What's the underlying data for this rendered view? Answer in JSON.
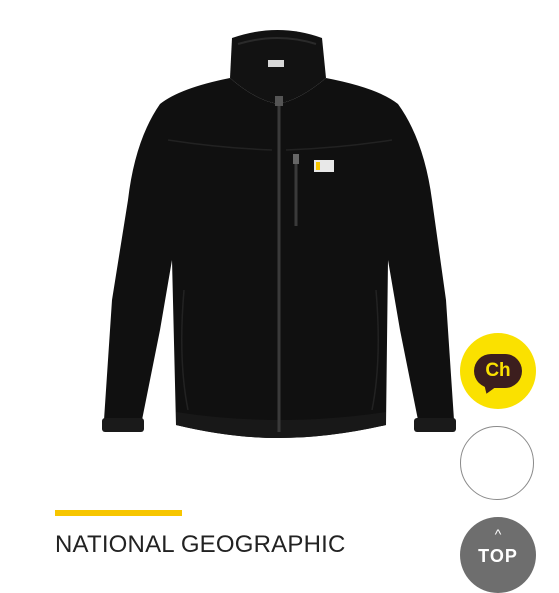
{
  "product": {
    "brand": "NATIONAL GEOGRAPHIC",
    "brand_accent_color": "#f7c600",
    "jacket_color": "#101010"
  },
  "floating_buttons": {
    "chat_label": "Ch",
    "chat_color": "#fae100",
    "top_arrow": "^",
    "top_label": "TOP"
  }
}
